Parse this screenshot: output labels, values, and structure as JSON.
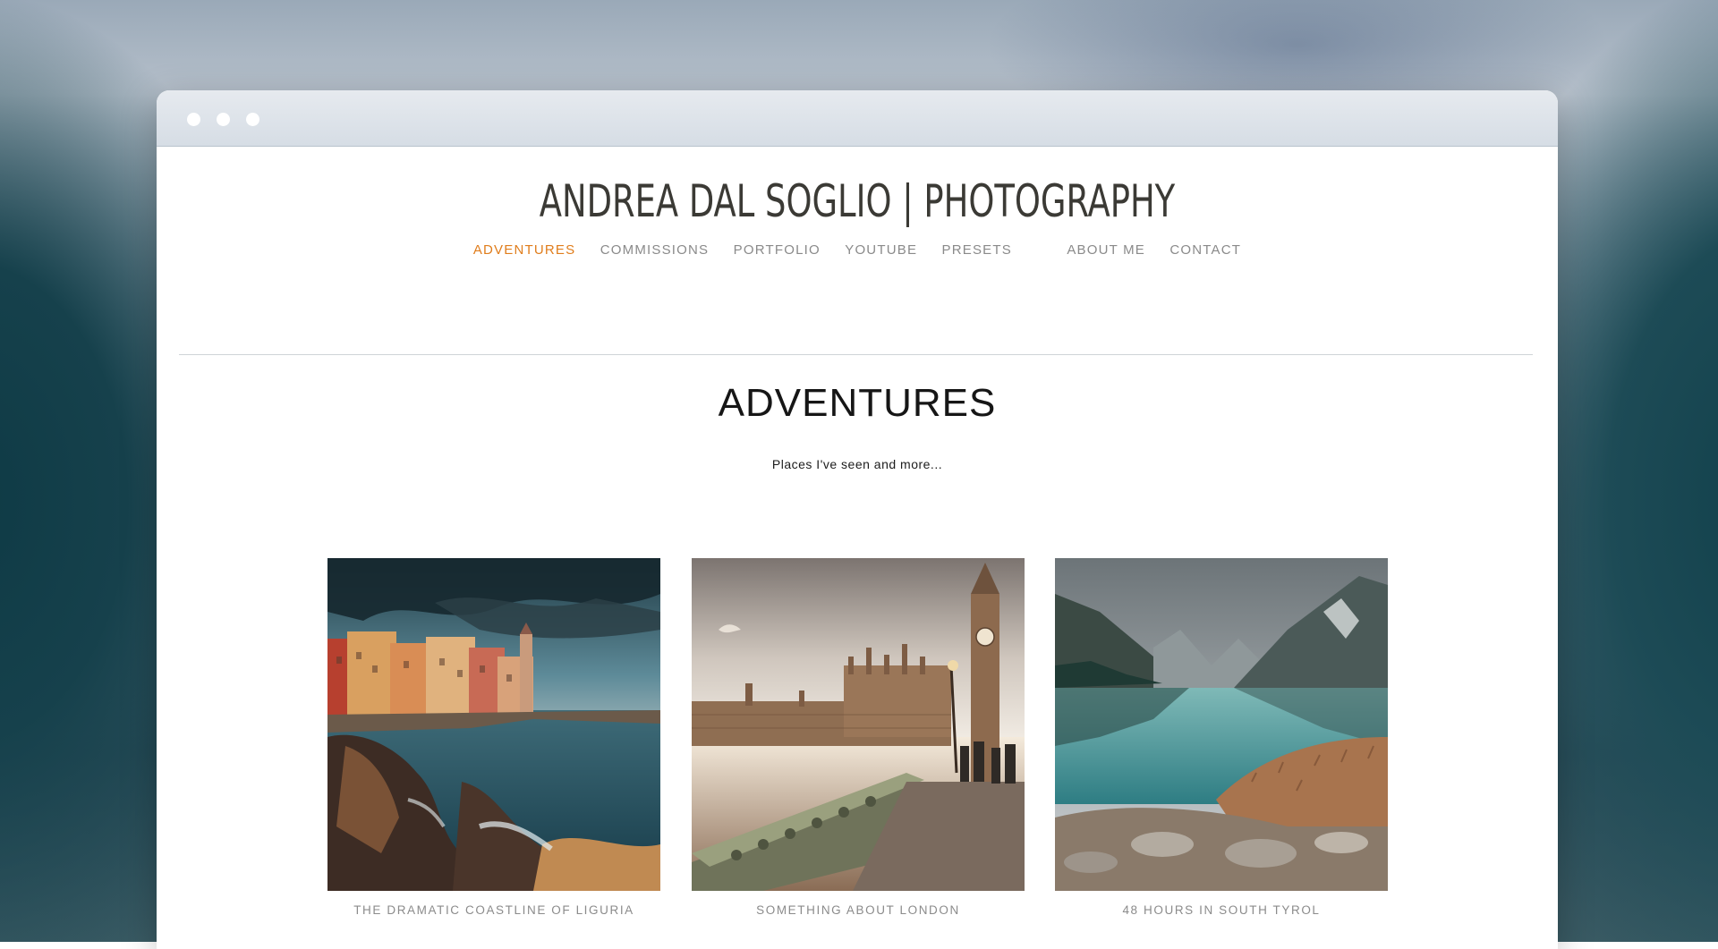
{
  "site": {
    "title": "ANDREA DAL SOGLIO | PHOTOGRAPHY"
  },
  "nav": {
    "items": [
      {
        "label": "ADVENTURES",
        "active": true
      },
      {
        "label": "COMMISSIONS",
        "active": false
      },
      {
        "label": "PORTFOLIO",
        "active": false
      },
      {
        "label": "YOUTUBE",
        "active": false
      },
      {
        "label": "PRESETS",
        "active": false
      },
      {
        "label": "ABOUT ME",
        "active": false
      },
      {
        "label": "CONTACT",
        "active": false
      }
    ],
    "active_color": "#e07d1c",
    "inactive_color": "#8a8a8a"
  },
  "page": {
    "heading": "ADVENTURES",
    "subheading": "Places I've seen and more..."
  },
  "gallery": [
    {
      "caption": "THE DRAMATIC COASTLINE OF LIGURIA",
      "image": "liguria-coast-photo"
    },
    {
      "caption": "SOMETHING ABOUT LONDON",
      "image": "london-big-ben-photo"
    },
    {
      "caption": "48 HOURS IN SOUTH TYROL",
      "image": "south-tyrol-lake-photo"
    }
  ]
}
